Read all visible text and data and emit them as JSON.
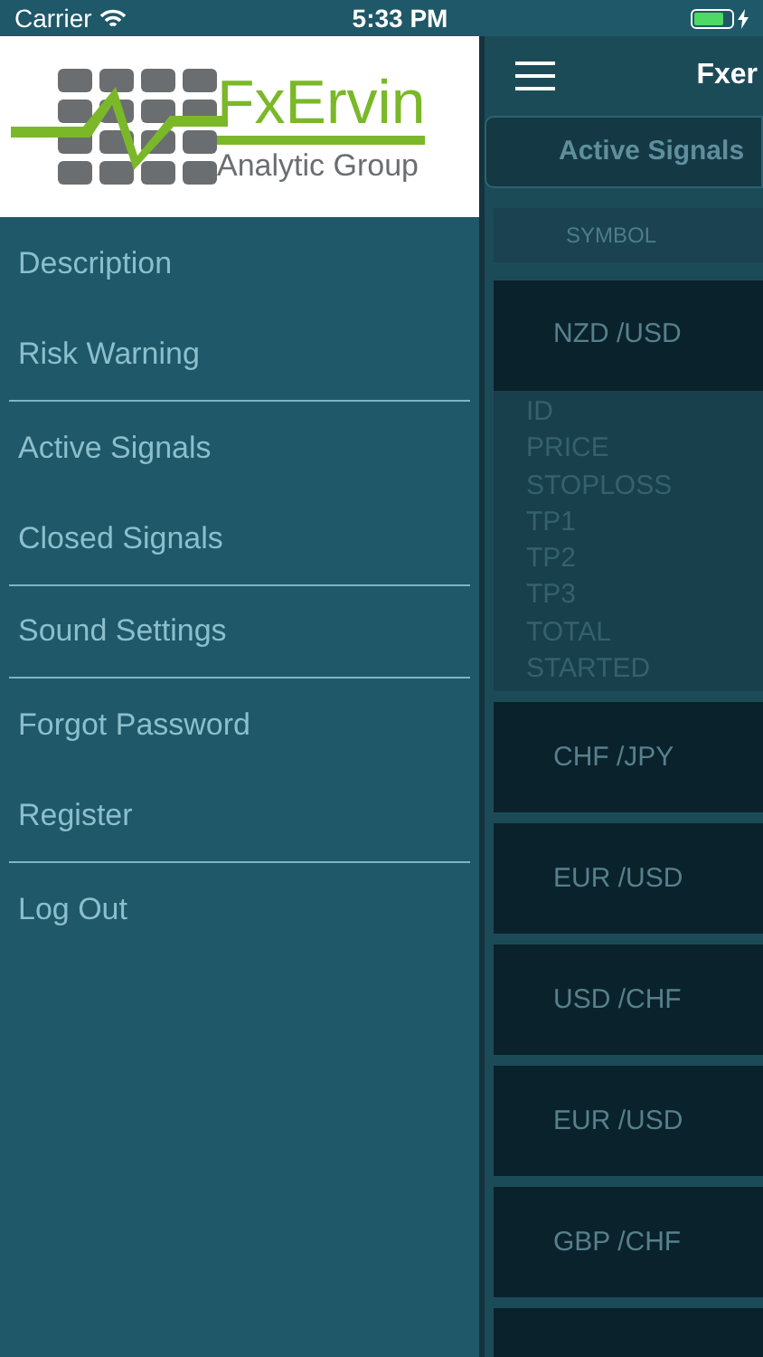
{
  "status_bar": {
    "carrier": "Carrier",
    "time": "5:33 PM"
  },
  "logo": {
    "name": "FxErvin",
    "tagline": "Analytic Group"
  },
  "menu": [
    {
      "label": "Description",
      "divider_after": false
    },
    {
      "label": "Risk Warning",
      "divider_after": true
    },
    {
      "label": "Active Signals",
      "divider_after": false
    },
    {
      "label": "Closed Signals",
      "divider_after": true
    },
    {
      "label": "Sound Settings",
      "divider_after": true
    },
    {
      "label": "Forgot Password",
      "divider_after": false
    },
    {
      "label": "Register",
      "divider_after": true
    },
    {
      "label": "Log Out",
      "divider_after": false
    }
  ],
  "main": {
    "title": "Fxer",
    "segment": "Active Signals",
    "column_header": "SYMBOL",
    "signals": [
      {
        "symbol": "NZD /USD",
        "expanded": true,
        "fields": [
          "ID",
          "PRICE",
          "STOPLOSS",
          "TP1",
          "TP2",
          "TP3",
          "TOTAL",
          "STARTED"
        ]
      },
      {
        "symbol": "CHF /JPY",
        "expanded": false
      },
      {
        "symbol": "EUR /USD",
        "expanded": false
      },
      {
        "symbol": "USD /CHF",
        "expanded": false
      },
      {
        "symbol": "EUR /USD",
        "expanded": false
      },
      {
        "symbol": "GBP /CHF",
        "expanded": false
      },
      {
        "expanded": false
      }
    ]
  }
}
